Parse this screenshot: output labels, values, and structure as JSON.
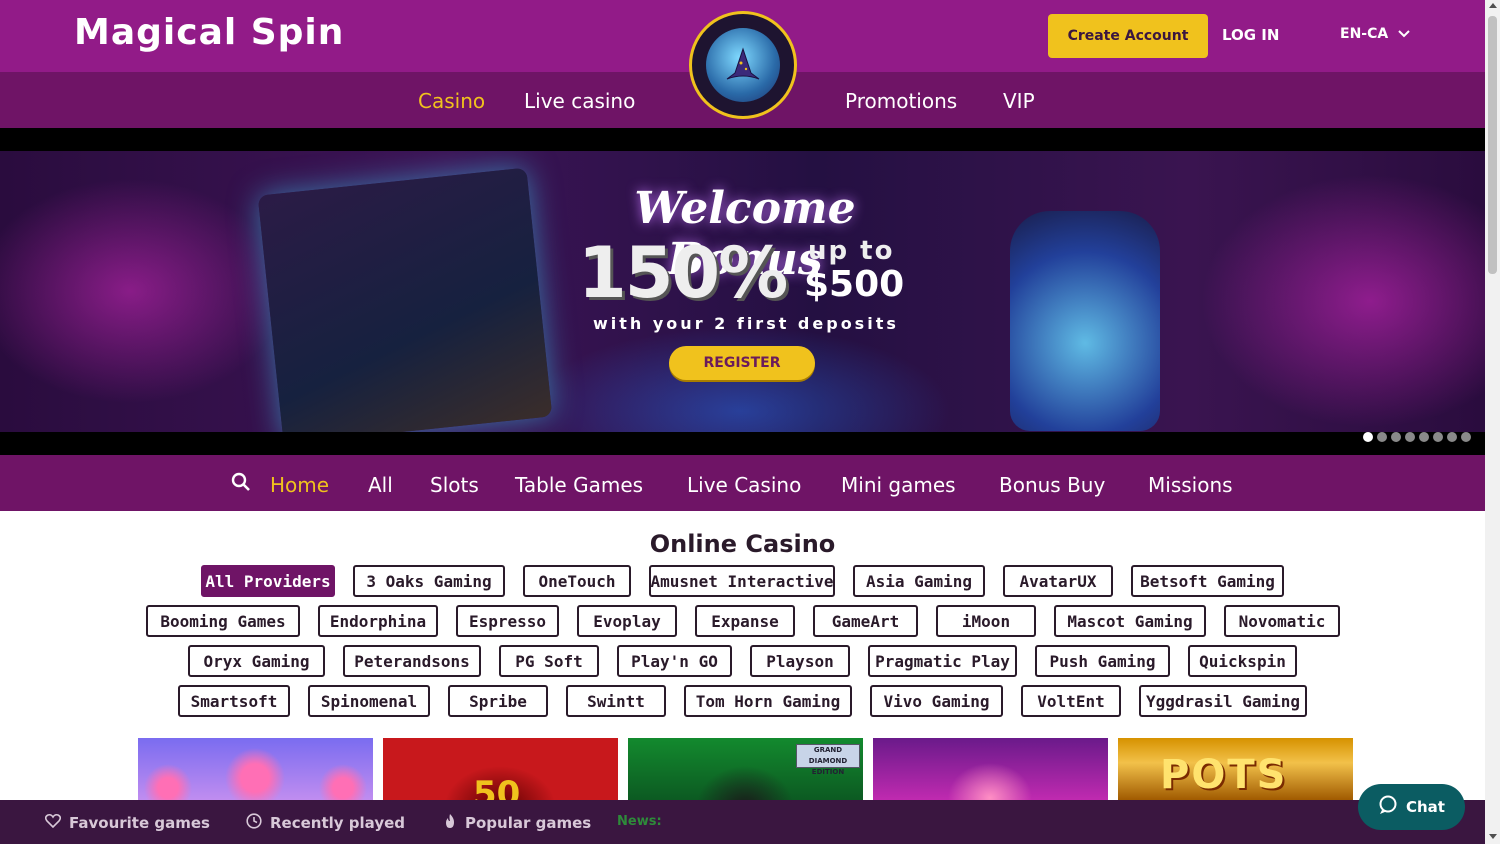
{
  "header": {
    "logo_text": "Magical Spin",
    "create_account": "Create Account",
    "login": "LOG IN",
    "language": "EN-CA"
  },
  "nav": {
    "items": [
      {
        "label": "Casino",
        "active": true
      },
      {
        "label": "Live casino",
        "active": false
      },
      {
        "label": "Promotions",
        "active": false
      },
      {
        "label": "VIP",
        "active": false
      }
    ]
  },
  "banner": {
    "title": "Welcome Bonus",
    "percent": "150%",
    "up_to": "up to",
    "amount": "$500",
    "subtitle": "with your 2 first deposits",
    "register": "REGISTER",
    "slide_count": 8,
    "active_slide": 1
  },
  "categories": {
    "items": [
      {
        "label": "Home",
        "active": true
      },
      {
        "label": "All",
        "active": false
      },
      {
        "label": "Slots",
        "active": false
      },
      {
        "label": "Table Games",
        "active": false
      },
      {
        "label": "Live Casino",
        "active": false
      },
      {
        "label": "Mini games",
        "active": false
      },
      {
        "label": "Bonus Buy",
        "active": false
      },
      {
        "label": "Missions",
        "active": false
      }
    ]
  },
  "online_casino": {
    "title": "Online Casino",
    "providers": [
      "All Providers",
      "3 Oaks Gaming",
      "OneTouch",
      "Amusnet Interactive",
      "Asia Gaming",
      "AvatarUX",
      "Betsoft Gaming",
      "Booming Games",
      "Endorphina",
      "Espresso",
      "Evoplay",
      "Expanse",
      "GameArt",
      "iMoon",
      "Mascot Gaming",
      "Novomatic",
      "Oryx Gaming",
      "Peterandsons",
      "PG Soft",
      "Play'n GO",
      "Playson",
      "Pragmatic Play",
      "Push Gaming",
      "Quickspin",
      "Smartsoft",
      "Spinomenal",
      "Spribe",
      "Swintt",
      "Tom Horn Gaming",
      "Vivo Gaming",
      "VoltEnt",
      "Yggdrasil Gaming"
    ],
    "active_provider": "All Providers"
  },
  "games": {
    "tile2_text": "50",
    "tile3_badge": "GRAND DIAMOND EDITION",
    "tile5_text": "POTS"
  },
  "bottom_bar": {
    "favourite": "Favourite games",
    "recent": "Recently played",
    "popular": "Popular games",
    "news": "News:"
  },
  "chat": {
    "label": "Chat"
  },
  "colors": {
    "header": "#921b88",
    "nav": "#6f1466",
    "accent": "#f0c21d",
    "bottom": "#3a1640",
    "chat": "#0b5c62"
  }
}
